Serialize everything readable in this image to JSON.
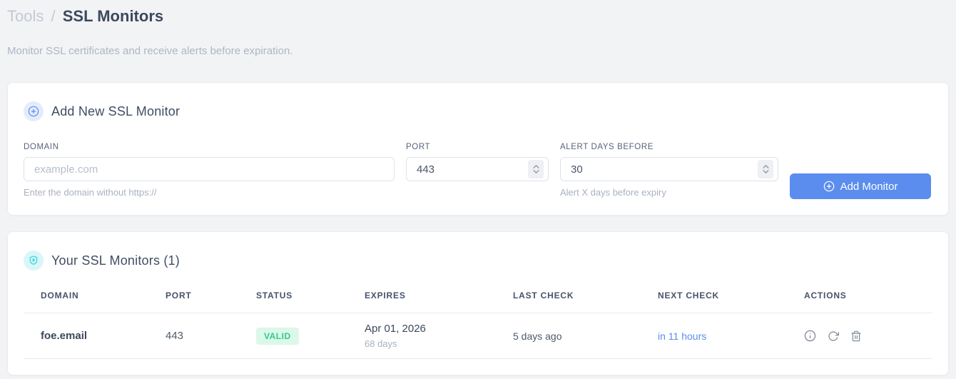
{
  "page": {
    "breadcrumb": {
      "section": "Tools",
      "separator": "/",
      "current": "SSL Monitors"
    },
    "subtitle": "Monitor SSL certificates and receive alerts before expiration."
  },
  "add_monitor": {
    "title": "Add New SSL Monitor",
    "fields": {
      "domain": {
        "label": "DOMAIN",
        "value": "",
        "placeholder": "example.com",
        "helper": "Enter the domain without https://"
      },
      "port": {
        "label": "PORT",
        "value": "443"
      },
      "alert_days": {
        "label": "ALERT DAYS BEFORE",
        "value": "30",
        "helper": "Alert X days before expiry"
      }
    },
    "submit_label": "Add Monitor"
  },
  "monitors": {
    "title": "Your SSL Monitors (1)",
    "table": {
      "headers": [
        "DOMAIN",
        "PORT",
        "STATUS",
        "EXPIRES",
        "LAST CHECK",
        "NEXT CHECK",
        "ACTIONS"
      ],
      "rows": [
        {
          "domain": "foe.email",
          "port": "443",
          "status": "VALID",
          "expires_date": "Apr 01, 2026",
          "expires_days": "68 days",
          "last_check": "5 days ago",
          "next_check": "in 11 hours"
        }
      ]
    }
  },
  "icons": {
    "add_card_icon": "plus-circle-icon",
    "monitors_card_icon": "shield-lock-icon",
    "submit_icon": "plus-circle-icon",
    "row_action_icons": [
      "info-icon",
      "refresh-icon",
      "trash-icon"
    ],
    "number_input": "stepper-chevrons"
  },
  "colors": {
    "accent_blue": "#5a8dee",
    "accent_blue_bg": "#e4ecfc",
    "success_green": "#2ecc87",
    "success_green_bg": "#dcf8ea",
    "cyan": "#2fd3e0",
    "cyan_bg": "#d9f6f9",
    "page_bg": "#f2f3f5",
    "dark_text": "#3c495c",
    "muted_text": "#a9b2c0"
  }
}
